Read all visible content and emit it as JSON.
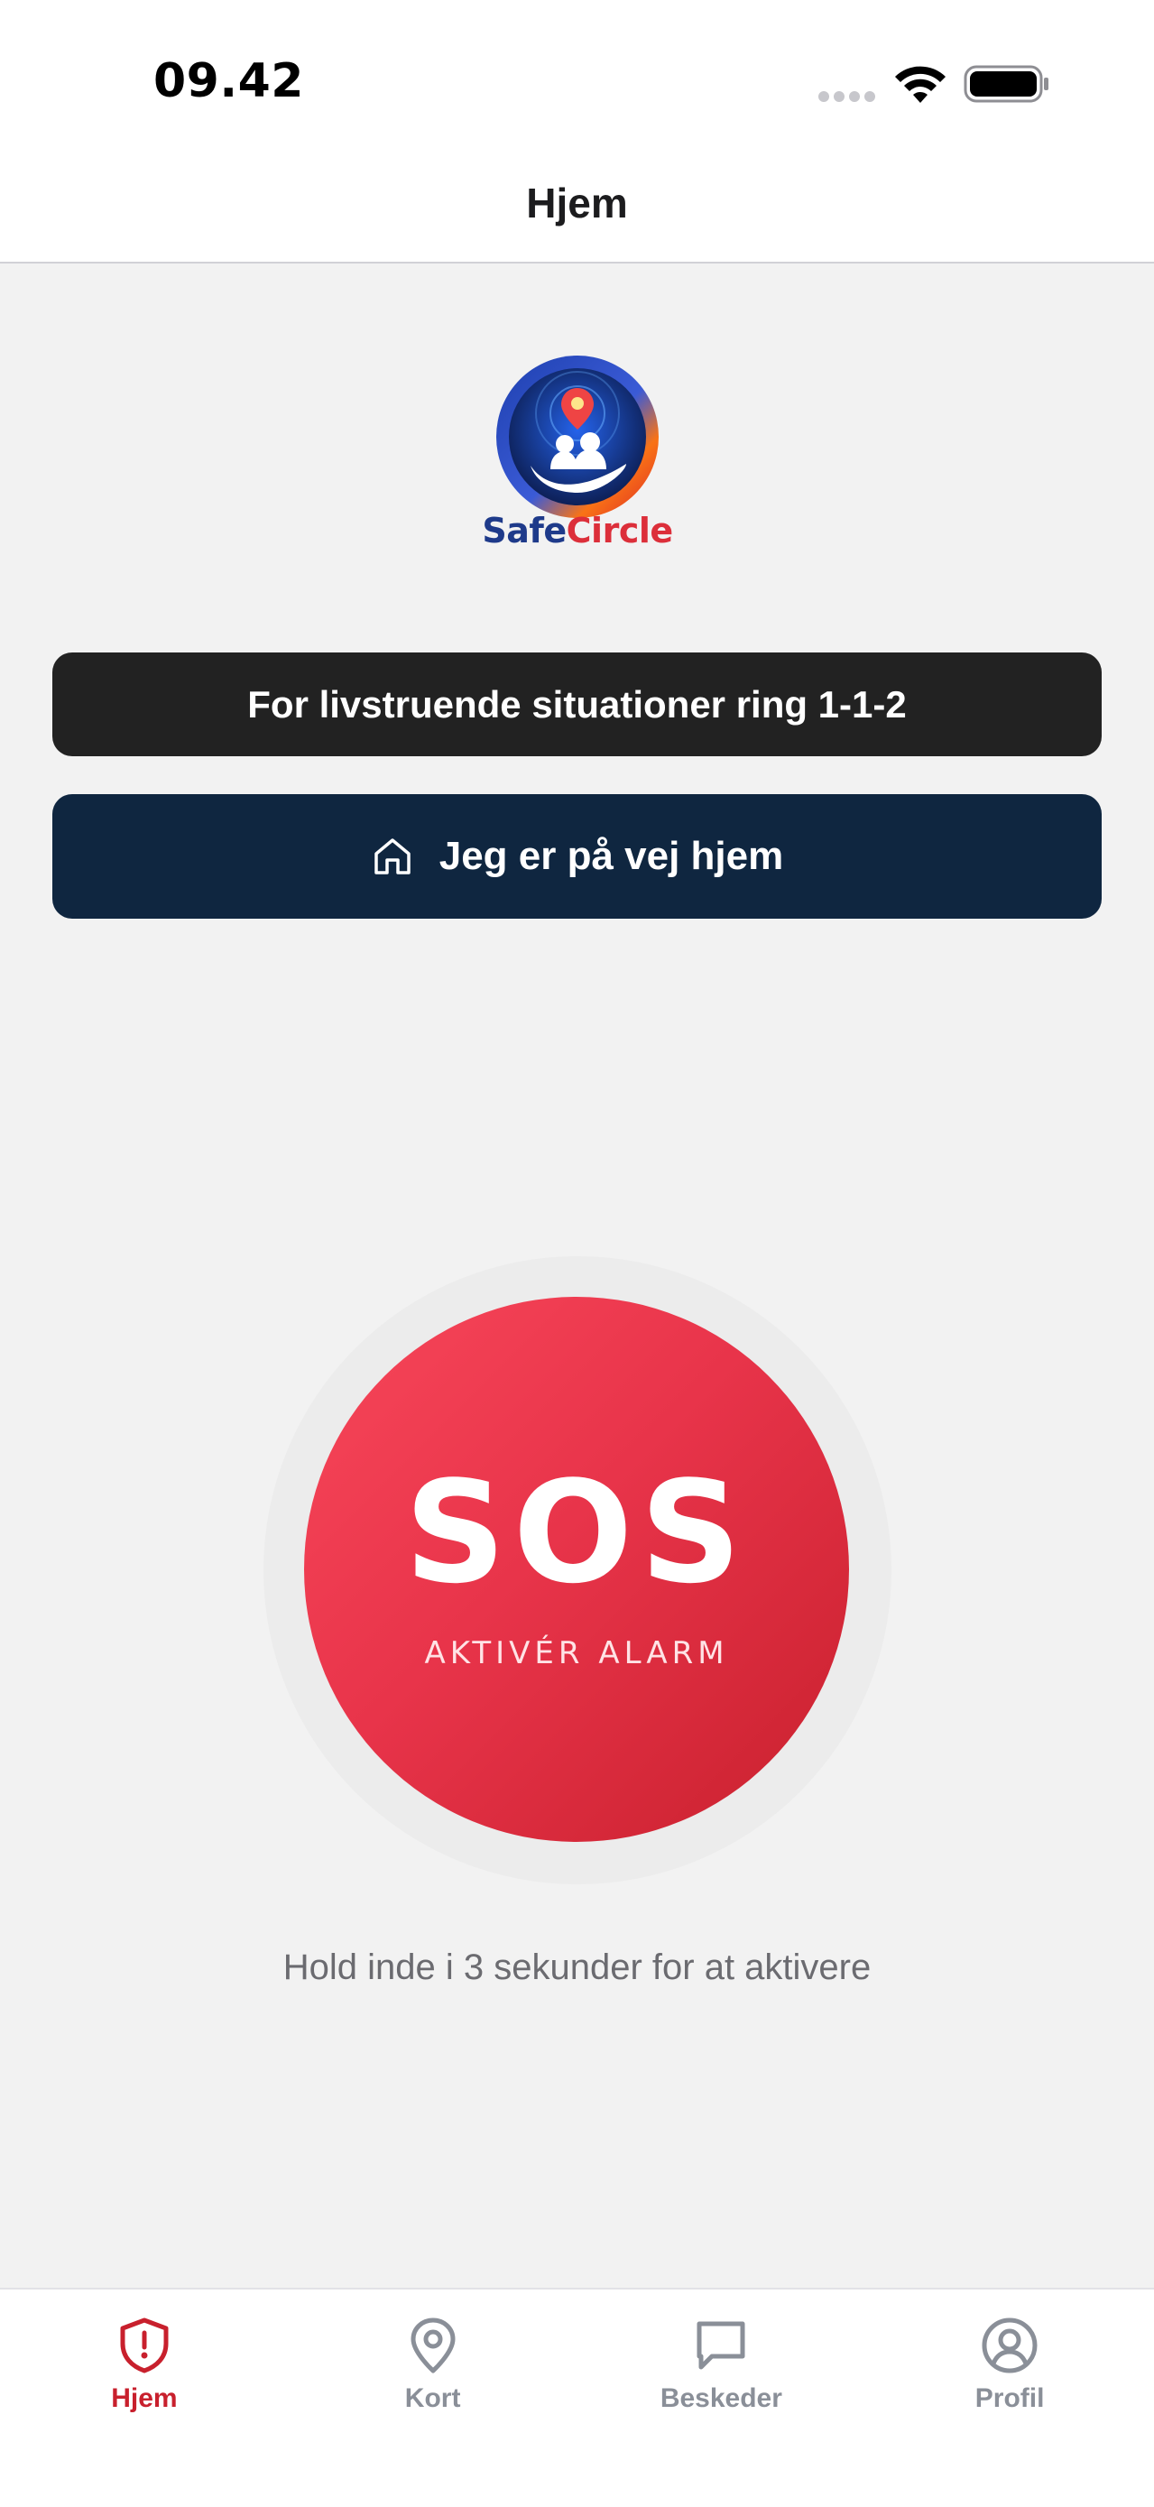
{
  "status_bar": {
    "time": "09.42"
  },
  "header": {
    "title": "Hjem"
  },
  "logo": {
    "text_part1": "Safe",
    "text_part2": "Circle"
  },
  "emergency_banner": {
    "label": "For livstruende situationer ring 1-1-2"
  },
  "home_button": {
    "icon": "home-icon",
    "label": "Jeg er på vej hjem"
  },
  "sos": {
    "label": "SOS",
    "sublabel": "AKTIVÉR ALARM",
    "hint": "Hold inde i 3 sekunder for at aktivere"
  },
  "tabs": [
    {
      "label": "Hjem",
      "icon": "shield-alert-icon",
      "active": true
    },
    {
      "label": "Kort",
      "icon": "map-pin-icon",
      "active": false
    },
    {
      "label": "Beskeder",
      "icon": "message-icon",
      "active": false
    },
    {
      "label": "Profil",
      "icon": "user-circle-icon",
      "active": false
    }
  ],
  "colors": {
    "accent": "#c8202d",
    "sos_red": "#e8344a",
    "banner_dark": "#222222",
    "navy": "#0f2640",
    "inactive": "#8a8f98"
  }
}
